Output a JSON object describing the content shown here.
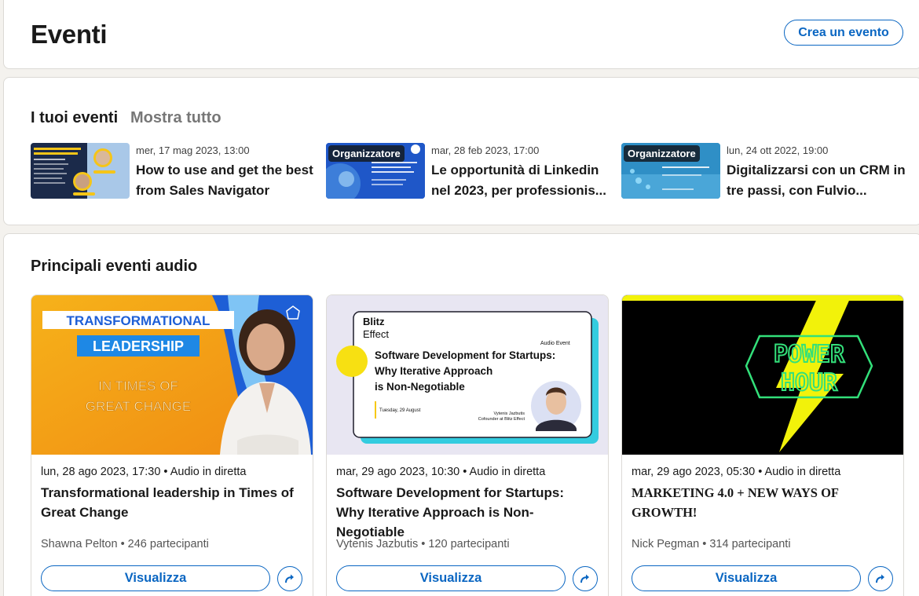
{
  "header": {
    "title": "Eventi",
    "create_label": "Crea un evento"
  },
  "my_events": {
    "title": "I tuoi eventi",
    "show_all": "Mostra tutto",
    "items": [
      {
        "date": "mer, 17 mag 2023, 13:00",
        "name": "How to use and get the best from Sales Navigator",
        "badge": "",
        "thumb_text": "HOW TO USE AND GET THE BEST FROM SALES NAVIGATOR"
      },
      {
        "date": "mar, 28 feb 2023, 17:00",
        "name": "Le opportunità di Linkedin nel 2023, per professionis...",
        "badge": "Organizzatore",
        "thumb_text": "Le nuove opportunità di Linkedin per professionisti e aziende"
      },
      {
        "date": "lun, 24 ott 2022, 19:00",
        "name": "Digitalizzarsi con un CRM in tre passi, con Fulvio...",
        "badge": "Organizzatore",
        "thumb_text": "I vantaggi dell'utilizzo di un crm"
      }
    ]
  },
  "audio_events": {
    "title": "Principali eventi audio",
    "view_label": "Visualizza",
    "cards": [
      {
        "meta": "lun, 28 ago 2023, 17:30  •  Audio in diretta",
        "title": "Transformational leadership in Times of Great Change",
        "host": "Shawna Pelton • 246 partecipanti",
        "img": {
          "line1": "TRANSFORMATIONAL",
          "line2": "LEADERSHIP",
          "line3": "IN TIMES OF",
          "line4": "GREAT CHANGE"
        }
      },
      {
        "meta": "mar, 29 ago 2023, 10:30  •  Audio in diretta",
        "title": "Software Development for Startups: Why Iterative Approach is Non-Negotiable",
        "host": "Vytenis Jazbutis • 120 partecipanti",
        "img": {
          "brand1": "Blitz",
          "brand2": "Effect",
          "tag": "Audio Event",
          "headline1": "Software Development for Startups:",
          "headline2": "Why Iterative Approach",
          "headline3": "is Non-Negotiable",
          "date": "Tuesday, 29 August",
          "person": "Vytenis Jazbutis",
          "role": "Cofounder at Blitz Effect"
        }
      },
      {
        "meta": "mar, 29 ago 2023, 05:30  •  Audio in diretta",
        "title": "MARKETING 4.0 + NEW WAYS OF GROWTH!",
        "host": "Nick Pegman • 314 partecipanti",
        "img": {
          "line1": "POWER",
          "line2": "HOUR"
        }
      }
    ]
  },
  "colors": {
    "accent": "#0a66c2",
    "page_bg": "#f4f2ee",
    "power_yellow": "#f2f20a",
    "power_green": "#33e07a"
  }
}
